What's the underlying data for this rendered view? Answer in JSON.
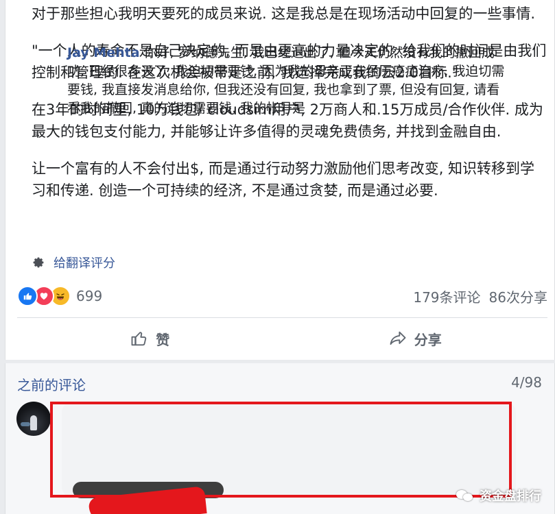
{
  "post": {
    "paragraphs": [
      "对于那些担心我明天要死的成员来说. 这是我总是在现场活动中回复的一些事情.",
      "\"一个人的寿命不是自己决定的, 而是由更高的力量决定的. 给我们的时间是由我们控制和管理的. 在这次机会被带走之前, 我选择完成我的云2.0目标.\"",
      "在3年的时间里, 10万钱包/ cloudsim用户, 2万商人和.15万成员/合作伙伴. 成为最大的钱包支付能力, 并能够让许多值得的灵魂免费债务, 并找到金融自由.",
      "让一个富有的人不会付出$, 而是通过行动努力激励他们思考改变, 知识转移到学习和传递. 创造一个可持续的经济, 不是通过贪婪, 而是通过必要."
    ],
    "translate_label": "给翻译评分",
    "reaction_count": "699",
    "comments_stat": "179条评论",
    "shares_stat": "86次分享",
    "like_label": "赞",
    "share_label": "分享"
  },
  "comments": {
    "previous_label": "之前的评论",
    "count_label": "4/98",
    "items": [
      {
        "author": "Jay Mehta",
        "text": "你好, 罗纳德先生, 我已经退出了, 但今天仍然没有我的撤回成功, 已经很多天了, 我迫切需要钱, 因为我的母亲正在经历癌症治疗, 我迫切需要钱, 我直接发消息给你, 但我还没有回复, 我也拿到了票, 但没有回复, 请看看我的撤回, 真的迫切需要钱. 我的帐号是"
      }
    ]
  },
  "watermark": {
    "text": "资金盘排行"
  },
  "icons": {
    "gear": "gear-icon",
    "like": "like-reaction-icon",
    "love": "love-reaction-icon",
    "haha": "haha-reaction-icon",
    "thumbs_up": "thumbs-up-icon",
    "share": "share-arrow-icon",
    "wechat": "wechat-logo-icon"
  },
  "colors": {
    "link": "#385898",
    "highlight_border": "#e4171c",
    "like_blue": "#1877f2",
    "love_red": "#f33e58",
    "haha_yellow": "#f7b928"
  }
}
